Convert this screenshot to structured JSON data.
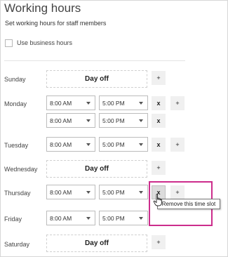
{
  "header": {
    "title": "Working hours",
    "subtitle": "Set working hours for staff members"
  },
  "business_hours": {
    "label": "Use business hours",
    "checked": false
  },
  "days": {
    "sunday": {
      "label": "Sunday",
      "day_off": "Day off"
    },
    "monday": {
      "label": "Monday",
      "slots": [
        {
          "start": "8:00 AM",
          "end": "5:00 PM"
        },
        {
          "start": "8:00 AM",
          "end": "5:00 PM"
        }
      ]
    },
    "tuesday": {
      "label": "Tuesday",
      "slots": [
        {
          "start": "8:00 AM",
          "end": "5:00 PM"
        }
      ]
    },
    "wednesday": {
      "label": "Wednesday",
      "day_off": "Day off"
    },
    "thursday": {
      "label": "Thursday",
      "slots": [
        {
          "start": "8:00 AM",
          "end": "5:00 PM"
        }
      ]
    },
    "friday": {
      "label": "Friday",
      "slots": [
        {
          "start": "8:00 AM",
          "end": "5:00 PM"
        }
      ]
    },
    "saturday": {
      "label": "Saturday",
      "day_off": "Day off"
    }
  },
  "buttons": {
    "add": "+",
    "remove": "x"
  },
  "tooltip": "Remove this time slot",
  "colors": {
    "highlight": "#cc2d8c",
    "button_bg": "#f0f0f0",
    "border": "#bcbcbc"
  }
}
